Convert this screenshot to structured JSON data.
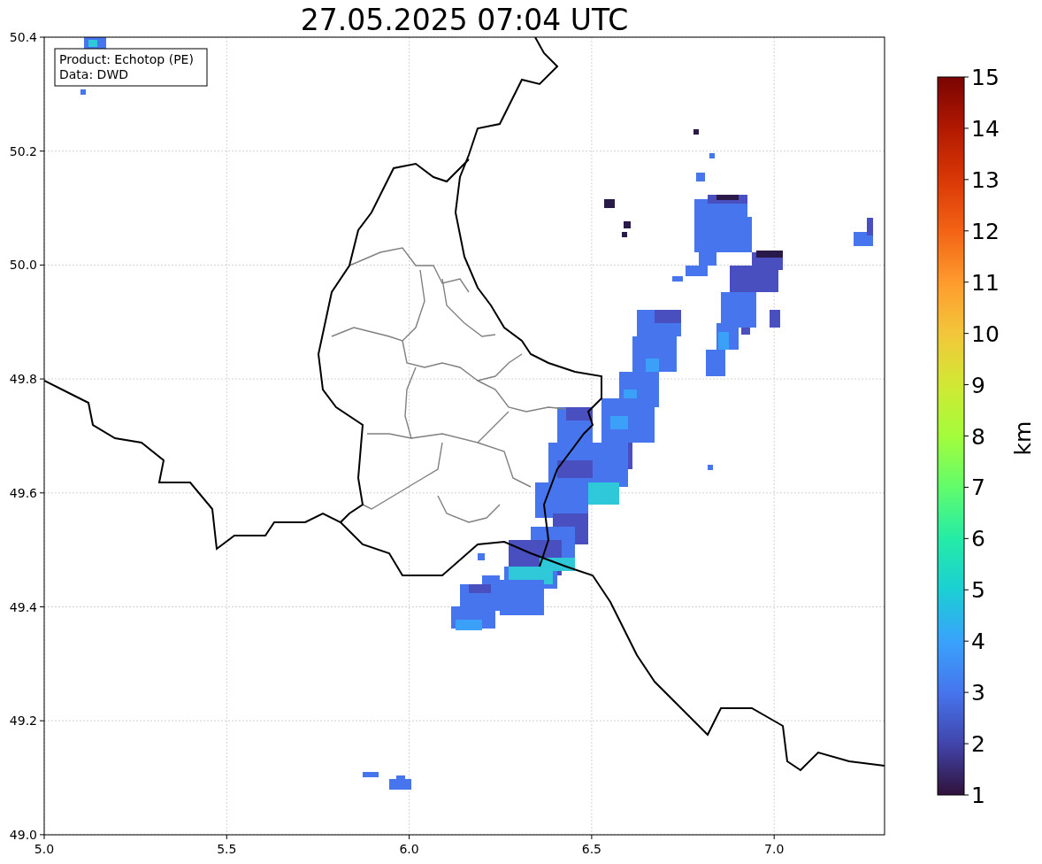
{
  "title": "27.05.2025 07:04 UTC",
  "info_box": [
    "Product: Echotop (PE)",
    "Data: DWD"
  ],
  "x_ticks": [
    "5.0",
    "5.5",
    "6.0",
    "6.5",
    "7.0"
  ],
  "y_ticks": [
    "50.4",
    "50.2",
    "50.0",
    "49.8",
    "49.6",
    "49.4",
    "49.2",
    "49.0"
  ],
  "colorbar": {
    "label": "km",
    "ticks": [
      "15",
      "14",
      "13",
      "12",
      "11",
      "10",
      "9",
      "8",
      "7",
      "6",
      "5",
      "4",
      "3",
      "2",
      "1"
    ]
  }
}
